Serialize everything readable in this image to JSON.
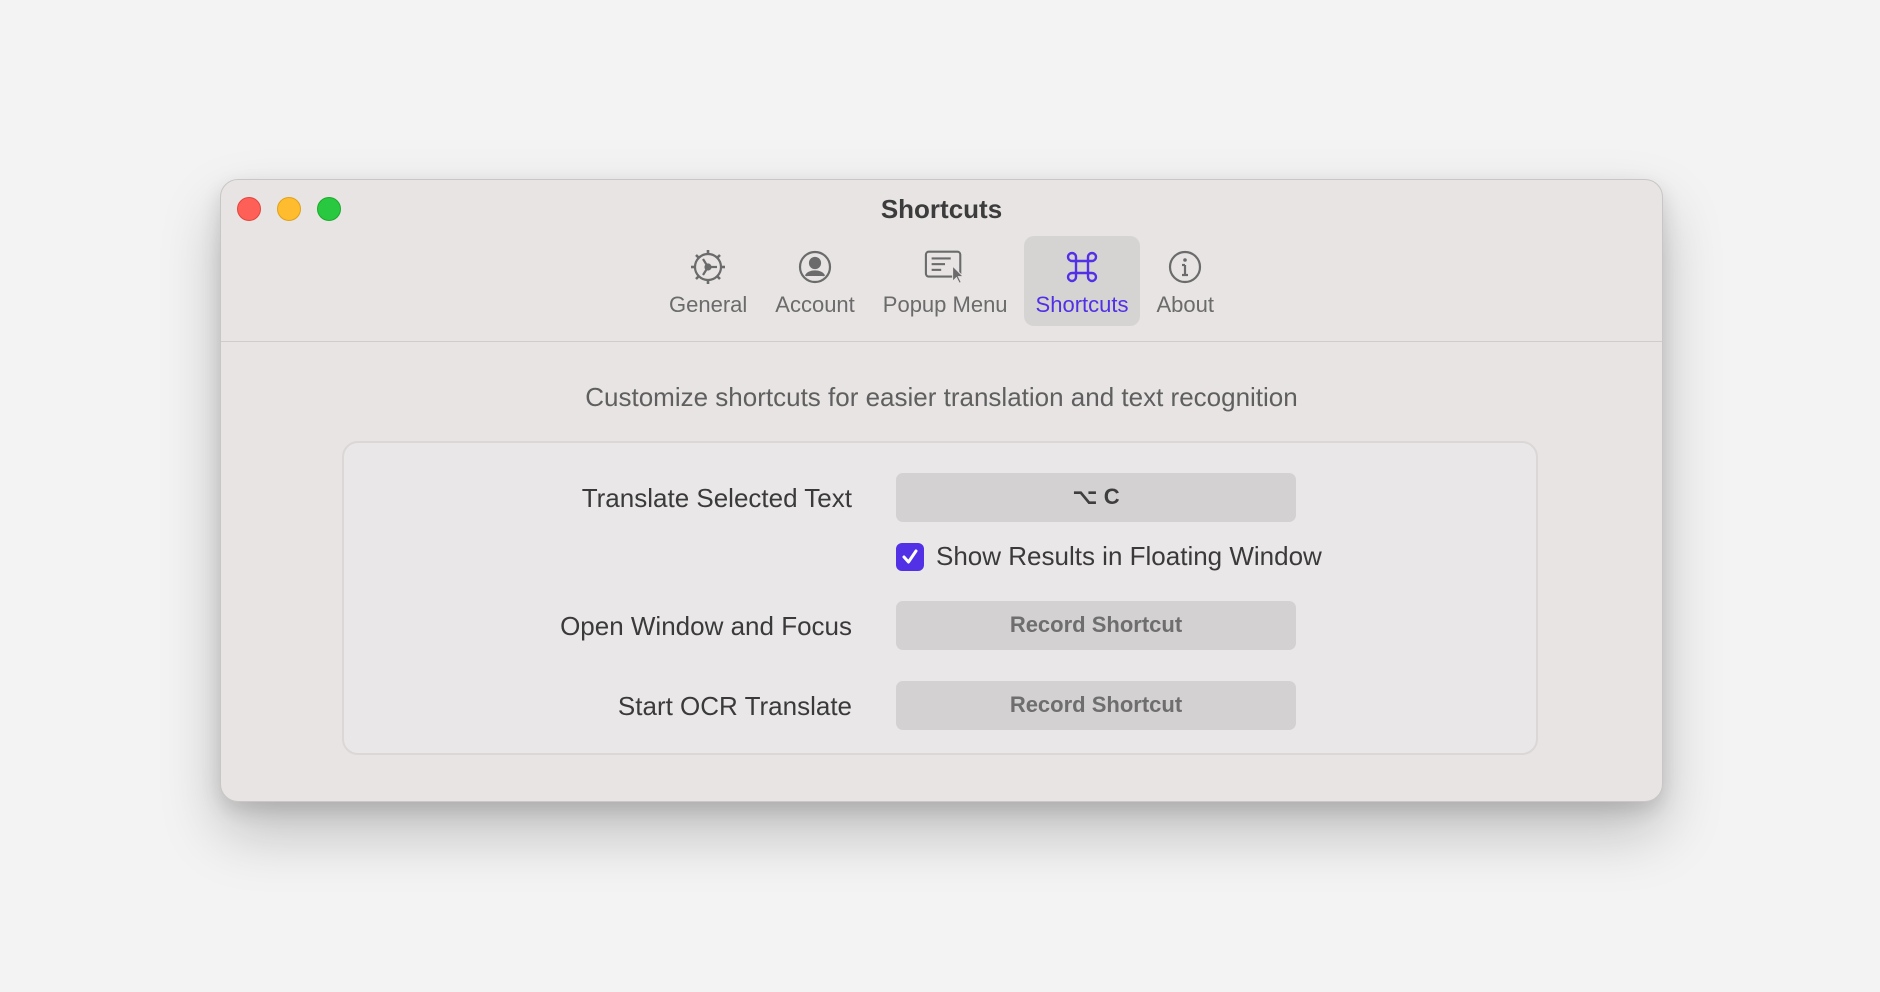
{
  "window": {
    "title": "Shortcuts"
  },
  "tabs": [
    {
      "label": "General",
      "icon": "gear-icon"
    },
    {
      "label": "Account",
      "icon": "person-circle-icon"
    },
    {
      "label": "Popup Menu",
      "icon": "popup-menu-icon"
    },
    {
      "label": "Shortcuts",
      "icon": "command-icon",
      "active": true
    },
    {
      "label": "About",
      "icon": "info-icon"
    }
  ],
  "main": {
    "subtitle": "Customize shortcuts for easier translation and text recognition",
    "rows": [
      {
        "label": "Translate Selected Text",
        "shortcut": "⌥ C"
      },
      {
        "label": "Open Window and Focus",
        "shortcut": "Record Shortcut"
      },
      {
        "label": "Start OCR Translate",
        "shortcut": "Record Shortcut"
      }
    ],
    "floating_option": {
      "label": "Show Results in Floating Window",
      "checked": true
    }
  },
  "colors": {
    "accent": "#5130e6",
    "window_bg": "#e7e4e3",
    "close": "#fe5f57",
    "minimize": "#febc2e",
    "maximize": "#28c840"
  }
}
